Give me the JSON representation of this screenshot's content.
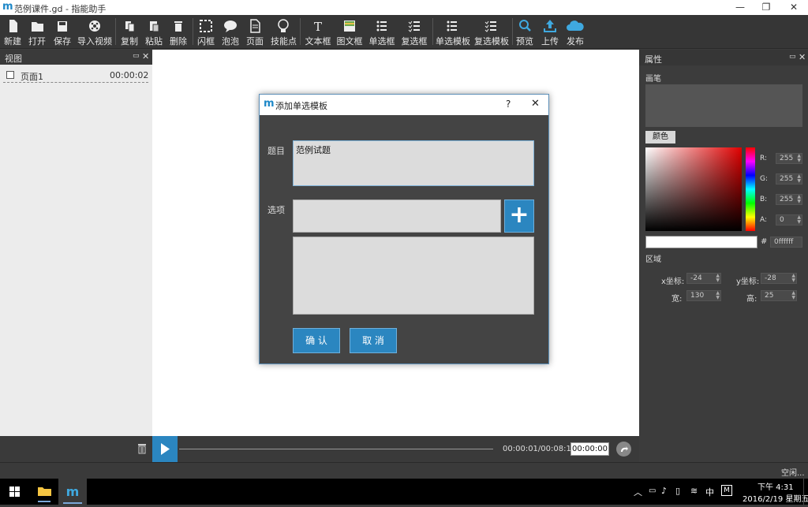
{
  "window": {
    "logo": "m",
    "title": "范例课件.gd - 指能助手",
    "min": "—",
    "restore": "❐",
    "close": "✕"
  },
  "toolbar": {
    "new": "新建",
    "open": "打开",
    "save": "保存",
    "import_video": "导入视频",
    "copy": "复制",
    "paste": "粘贴",
    "delete": "删除",
    "flash_frame": "闪框",
    "bubble": "泡泡",
    "page": "页面",
    "tip_point": "技能点",
    "text_frame": "文本框",
    "image_text_frame": "图文框",
    "single_choice": "单选框",
    "multi_choice": "复选框",
    "single_template": "单选模板",
    "multi_template": "复选模板",
    "preview": "预览",
    "upload": "上传",
    "publish": "发布"
  },
  "left_panel": {
    "title": "视图",
    "pages": [
      {
        "name": "页面1",
        "time": "00:00:02"
      }
    ]
  },
  "timeline": {
    "time_display": "00:00:01/00:08:12",
    "time_input": "00:00:00"
  },
  "right_panel": {
    "title": "属性",
    "brush_label": "画笔",
    "color_button": "颜色",
    "r_label": "R:",
    "r_value": "255",
    "g_label": "G:",
    "g_value": "255",
    "b_label": "B:",
    "b_value": "255",
    "a_label": "A:",
    "a_value": "0",
    "hex_label": "#",
    "hex_value": "0ffffff",
    "region_label": "区域",
    "x_label": "x坐标:",
    "x_value": "-24",
    "y_label": "y坐标:",
    "y_value": "-28",
    "w_label": "宽:",
    "w_value": "130",
    "h_label": "高:",
    "h_value": "25"
  },
  "status": {
    "text": "空闲..."
  },
  "taskbar": {
    "time": "下午 4:31",
    "date": "2016/2/19 星期五",
    "ime": "中",
    "ime_m": "M"
  },
  "dialog": {
    "logo": "m",
    "title": "添加单选模板",
    "help": "?",
    "close": "✕",
    "question_label": "题目",
    "question_value": "范例试题",
    "options_label": "选项",
    "add_button": "+",
    "confirm": "确 认",
    "cancel": "取 消"
  },
  "colors": {
    "accent": "#2b86c0",
    "panel_dark": "#3c3c3c",
    "canvas": "#ffffff"
  }
}
